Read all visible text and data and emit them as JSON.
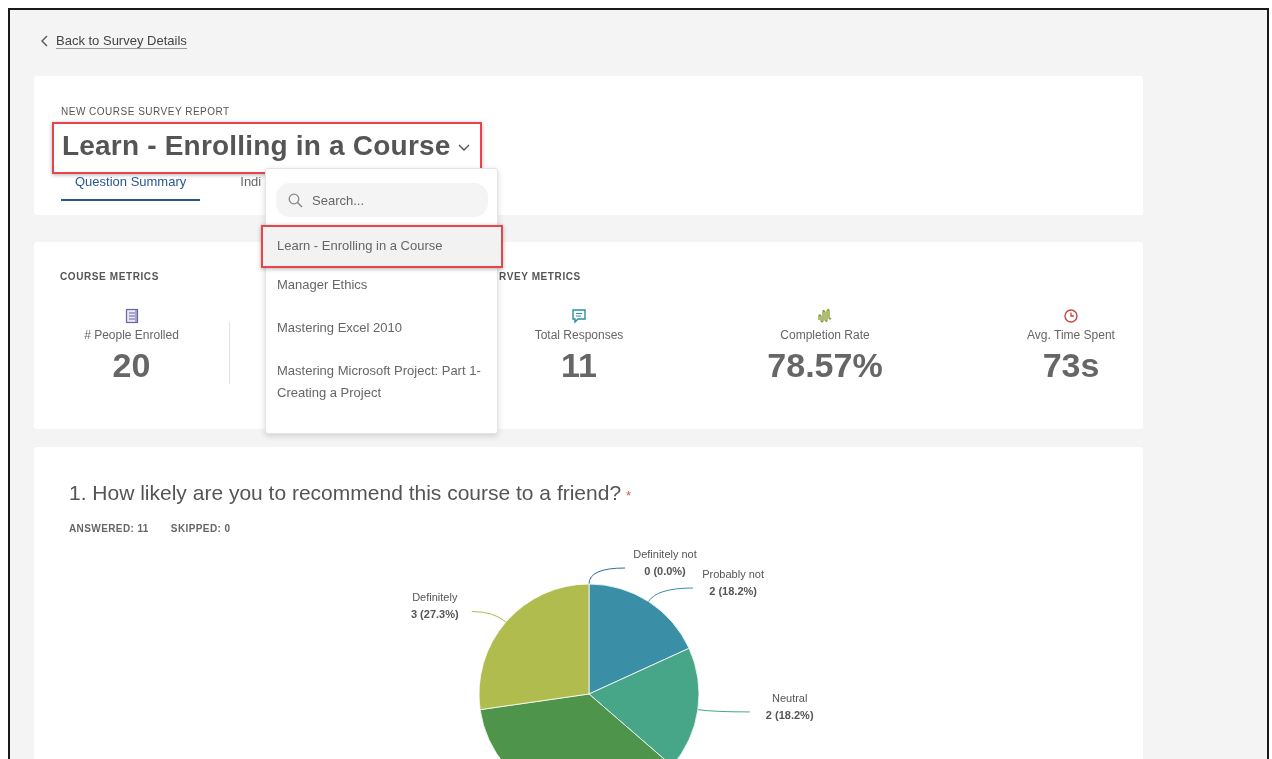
{
  "back_link": "Back to Survey Details",
  "header": {
    "eyebrow": "NEW COURSE SURVEY REPORT",
    "title": "Learn - Enrolling in a Course",
    "title_highlighted": true,
    "tabs": [
      {
        "label": "Question Summary",
        "selected": true
      },
      {
        "label": "Indi",
        "selected": false
      }
    ]
  },
  "dropdown": {
    "search_placeholder": "Search...",
    "options": [
      {
        "label": "Learn - Enrolling in a Course",
        "selected": true,
        "highlighted": true
      },
      {
        "label": "Manager Ethics",
        "selected": false,
        "highlighted": false
      },
      {
        "label": "Mastering Excel 2010",
        "selected": false,
        "highlighted": false
      },
      {
        "label": "Mastering Microsoft Project: Part 1- Creating a Project",
        "selected": false,
        "highlighted": false
      }
    ]
  },
  "course_metrics": {
    "title": "COURSE METRICS",
    "items": [
      {
        "kind": "book",
        "label": "# People Enrolled",
        "value": "20"
      }
    ]
  },
  "survey_metrics": {
    "title": "RVEY METRICS",
    "items": [
      {
        "kind": "chat",
        "label": "Total Responses",
        "value": "11"
      },
      {
        "kind": "wave",
        "label": "Completion Rate",
        "value": "78.57%"
      },
      {
        "kind": "clock",
        "label": "Avg. Time Spent",
        "value": "73s"
      }
    ]
  },
  "question": {
    "text": "1. How likely are you to recommend this course to a friend?",
    "required_mark": "*",
    "answered": "ANSWERED: 11",
    "skipped": "SKIPPED: 0",
    "chart_data": {
      "type": "pie",
      "categories": [
        "Definitely not",
        "Probably not",
        "Neutral",
        null,
        "Definitely"
      ],
      "values": [
        0,
        2,
        2,
        4,
        3
      ],
      "colors": [
        "#2e6f9e",
        "#3a8fa6",
        "#48a688",
        "#4e944a",
        "#b0bc4e"
      ],
      "value_labels": [
        "0 (0.0%)",
        "2 (18.2%)",
        "2 (18.2%)",
        null,
        "3 (27.3%)"
      ]
    }
  }
}
